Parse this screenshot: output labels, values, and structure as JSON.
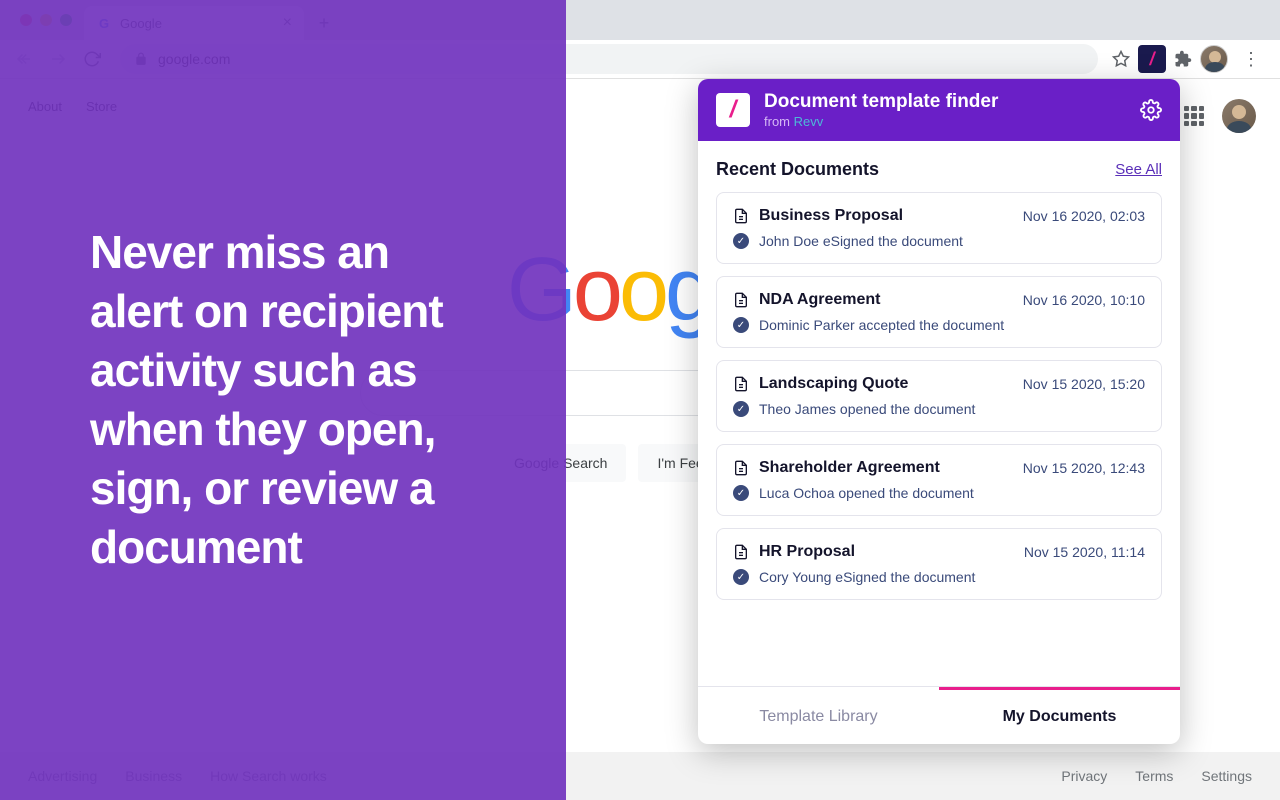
{
  "browser": {
    "tab_title": "Google",
    "url": "google.com"
  },
  "google": {
    "top_links": {
      "about": "About",
      "store": "Store"
    },
    "btn_search": "Google Search",
    "btn_lucky": "I'm Feeling Lucky",
    "footer_left": {
      "ads": "Advertising",
      "biz": "Business",
      "how": "How Search works"
    },
    "footer_right": {
      "privacy": "Privacy",
      "terms": "Terms",
      "settings": "Settings"
    }
  },
  "overlay": {
    "headline": "Never miss an alert on recipient activity such as when they open, sign, or review a document"
  },
  "popup": {
    "title": "Document template finder",
    "from": "from ",
    "brand": "Revv",
    "section_title": "Recent Documents",
    "see_all": "See All",
    "tabs": {
      "library": "Template Library",
      "mydocs": "My Documents"
    },
    "docs": [
      {
        "name": "Business Proposal",
        "time": "Nov 16 2020, 02:03",
        "status": "John Doe eSigned the document"
      },
      {
        "name": "NDA Agreement",
        "time": "Nov 16 2020, 10:10",
        "status": "Dominic Parker accepted the document"
      },
      {
        "name": "Landscaping Quote",
        "time": "Nov 15 2020, 15:20",
        "status": "Theo James opened the document"
      },
      {
        "name": "Shareholder Agreement",
        "time": "Nov 15 2020, 12:43",
        "status": "Luca Ochoa opened the document"
      },
      {
        "name": "HR Proposal",
        "time": "Nov 15 2020, 11:14",
        "status": "Cory Young eSigned the document"
      }
    ]
  }
}
